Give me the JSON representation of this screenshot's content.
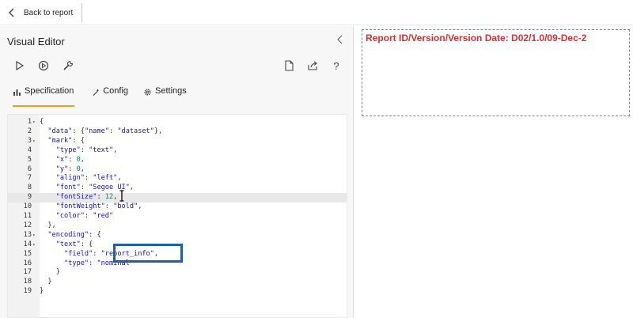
{
  "topbar": {
    "back_label": "Back to report"
  },
  "editor": {
    "title": "Visual Editor",
    "tabs": [
      {
        "label": "Specification",
        "active": true
      },
      {
        "label": "Config",
        "active": false
      },
      {
        "label": "Settings",
        "active": false
      }
    ],
    "highlighted_line": 9,
    "highlight_box_text": "\"report_info\","
  },
  "code_lines": [
    {
      "n": "1",
      "fold": true,
      "t": "{"
    },
    {
      "n": "2",
      "fold": false,
      "t": "  \"data\": {\"name\": \"dataset\"},"
    },
    {
      "n": "3",
      "fold": true,
      "t": "  \"mark\": {"
    },
    {
      "n": "4",
      "fold": false,
      "t": "    \"type\": \"text\","
    },
    {
      "n": "5",
      "fold": false,
      "t": "    \"x\": 0,"
    },
    {
      "n": "6",
      "fold": false,
      "t": "    \"y\": 0,"
    },
    {
      "n": "7",
      "fold": false,
      "t": "    \"align\": \"left\","
    },
    {
      "n": "8",
      "fold": false,
      "t": "    \"font\": \"Segoe UI\","
    },
    {
      "n": "9",
      "fold": false,
      "t": "    \"fontSize\": 12,"
    },
    {
      "n": "10",
      "fold": false,
      "t": "    \"fontWeight\": \"bold\","
    },
    {
      "n": "11",
      "fold": false,
      "t": "    \"color\": \"red\""
    },
    {
      "n": "12",
      "fold": false,
      "t": "  },"
    },
    {
      "n": "13",
      "fold": true,
      "t": "  \"encoding\": {"
    },
    {
      "n": "14",
      "fold": true,
      "t": "    \"text\": {"
    },
    {
      "n": "15",
      "fold": false,
      "t": "      \"field\": \"report_info\","
    },
    {
      "n": "16",
      "fold": false,
      "t": "      \"type\": \"nominal\""
    },
    {
      "n": "17",
      "fold": false,
      "t": "    }"
    },
    {
      "n": "18",
      "fold": false,
      "t": "  }"
    },
    {
      "n": "19",
      "fold": false,
      "t": "}"
    }
  ],
  "visual": {
    "text": "Report ID/Version/Version Date: D02/1.0/09-Dec-2",
    "color": "#d13438"
  },
  "icons": [
    "chevron-left-icon",
    "collapse-panel-icon",
    "run-icon",
    "auto-apply-icon",
    "wrench-icon",
    "new-spec-icon",
    "share-icon",
    "help-icon",
    "chart-icon",
    "magic-icon",
    "gear-icon",
    "text-cursor-icon"
  ]
}
